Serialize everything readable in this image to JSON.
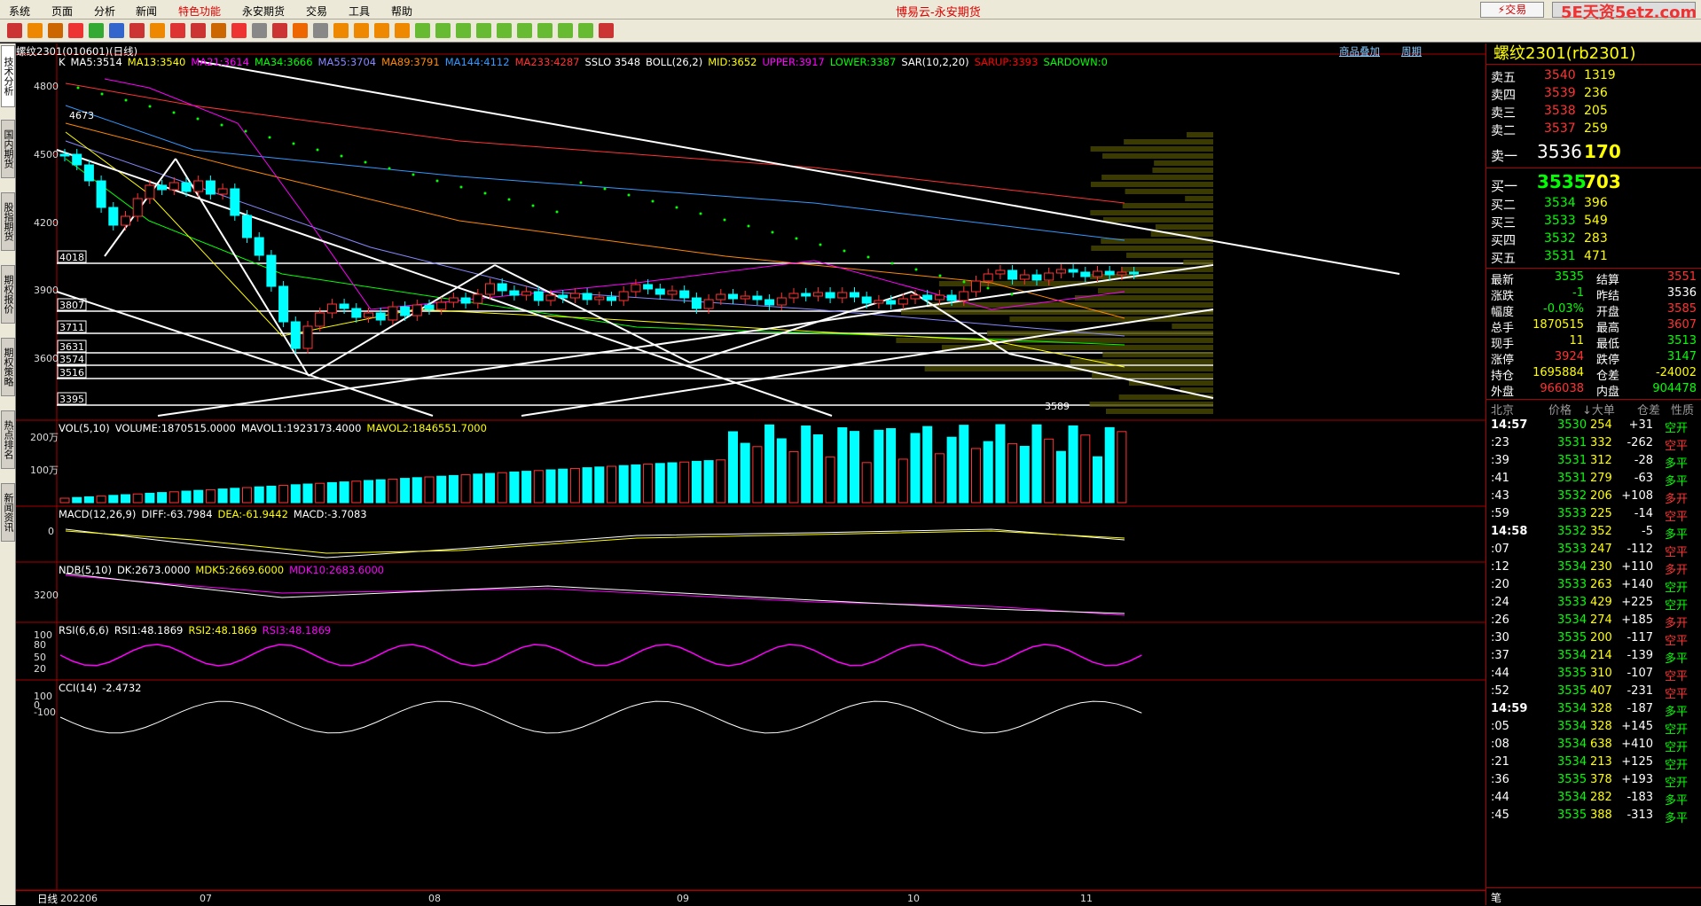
{
  "menu": [
    "系统",
    "页面",
    "分析",
    "新闻",
    "特色功能",
    "永安期货",
    "交易",
    "工具",
    "帮助"
  ],
  "window_title": "博易云-永安期货",
  "trade_button": "⚡交易",
  "watermark": "5E天资5etz.com",
  "left_tabs": [
    "技术分析",
    "国内期货",
    "股指期货",
    "期权报价",
    "期权策略",
    "热点排名",
    "新闻资讯"
  ],
  "chart": {
    "header_left": "螺纹2301(010601)(日线)",
    "header_links": [
      "商品叠加",
      "周期"
    ],
    "ma_line": [
      {
        "t": "K",
        "c": "#ffffff"
      },
      {
        "t": "MA5:3514",
        "c": "#ffffff"
      },
      {
        "t": "MA13:3540",
        "c": "#ffff00"
      },
      {
        "t": "MA21:3614",
        "c": "#ff00ff"
      },
      {
        "t": "MA34:3666",
        "c": "#00ff00"
      },
      {
        "t": "MA55:3704",
        "c": "#8888ff"
      },
      {
        "t": "MA89:3791",
        "c": "#ff8800"
      },
      {
        "t": "MA144:4112",
        "c": "#3399ff"
      },
      {
        "t": "MA233:4287",
        "c": "#ff3333"
      },
      {
        "t": "SSLO 3548",
        "c": "#ffffff"
      },
      {
        "t": "BOLL(26,2)",
        "c": "#ffffff"
      },
      {
        "t": "MID:3652",
        "c": "#ffff00"
      },
      {
        "t": "UPPER:3917",
        "c": "#ff00ff"
      },
      {
        "t": "LOWER:3387",
        "c": "#00ff00"
      },
      {
        "t": "SAR(10,2,20)",
        "c": "#ffffff"
      },
      {
        "t": "SARUP:3393",
        "c": "#ff0000"
      },
      {
        "t": "SARDOWN:0",
        "c": "#00ff00"
      }
    ],
    "price_ticks": [
      "4800",
      "4500",
      "4200",
      "3900",
      "3600"
    ],
    "price_boxes": [
      "4018",
      "3807",
      "3711",
      "3631",
      "3574",
      "3516",
      "3395"
    ],
    "high_label": "4673",
    "low_label": "3589",
    "vol_line": [
      {
        "t": "VOL(5,10)",
        "c": "#ffffff"
      },
      {
        "t": "VOLUME:1870515.0000",
        "c": "#ffffff"
      },
      {
        "t": "MAVOL1:1923173.4000",
        "c": "#ffffff"
      },
      {
        "t": "MAVOL2:1846551.7000",
        "c": "#ffff00"
      }
    ],
    "vol_ticks": [
      "200万",
      "100万"
    ],
    "macd_line": [
      {
        "t": "MACD(12,26,9)",
        "c": "#ffffff"
      },
      {
        "t": "DIFF:-63.7984",
        "c": "#ffffff"
      },
      {
        "t": "DEA:-61.9442",
        "c": "#ffff00"
      },
      {
        "t": "MACD:-3.7083",
        "c": "#ffffff"
      }
    ],
    "macd_ticks": [
      "0"
    ],
    "ndb_line": [
      {
        "t": "NDB(5,10)",
        "c": "#ffffff"
      },
      {
        "t": "DK:2673.0000",
        "c": "#ffffff"
      },
      {
        "t": "MDK5:2669.6000",
        "c": "#ffff00"
      },
      {
        "t": "MDK10:2683.6000",
        "c": "#ff00ff"
      }
    ],
    "ndb_ticks": [
      "3200"
    ],
    "rsi_line": [
      {
        "t": "RSI(6,6,6)",
        "c": "#ffffff"
      },
      {
        "t": "RSI1:48.1869",
        "c": "#ffffff"
      },
      {
        "t": "RSI2:48.1869",
        "c": "#ffff00"
      },
      {
        "t": "RSI3:48.1869",
        "c": "#ff00ff"
      }
    ],
    "rsi_ticks": [
      "100",
      "80",
      "50",
      "20"
    ],
    "cci_line": [
      {
        "t": "CCI(14)",
        "c": "#ffffff"
      },
      {
        "t": "-2.4732",
        "c": "#ffffff"
      }
    ],
    "cci_ticks": [
      "100",
      "0",
      "-100"
    ],
    "footer_label": "日线",
    "date_ticks": [
      "202206",
      "07",
      "08",
      "09",
      "10",
      "11"
    ]
  },
  "quote": {
    "title": "螺纹2301(rb2301)",
    "asks": [
      {
        "label": "卖五",
        "price": "3540",
        "vol": "1319"
      },
      {
        "label": "卖四",
        "price": "3539",
        "vol": "236"
      },
      {
        "label": "卖三",
        "price": "3538",
        "vol": "205"
      },
      {
        "label": "卖二",
        "price": "3537",
        "vol": "259"
      },
      {
        "label": "卖一",
        "price": "3536",
        "vol": "170"
      }
    ],
    "bids": [
      {
        "label": "买一",
        "price": "3535",
        "vol": "703"
      },
      {
        "label": "买二",
        "price": "3534",
        "vol": "396"
      },
      {
        "label": "买三",
        "price": "3533",
        "vol": "549"
      },
      {
        "label": "买四",
        "price": "3532",
        "vol": "283"
      },
      {
        "label": "买五",
        "price": "3531",
        "vol": "471"
      }
    ],
    "stats": [
      {
        "l1": "最新",
        "v1": "3535",
        "c1": "green",
        "l2": "结算",
        "v2": "3551",
        "c2": "red"
      },
      {
        "l1": "涨跌",
        "v1": "-1",
        "c1": "green",
        "l2": "昨结",
        "v2": "3536",
        "c2": "white"
      },
      {
        "l1": "幅度",
        "v1": "-0.03%",
        "c1": "green",
        "l2": "开盘",
        "v2": "3585",
        "c2": "red"
      },
      {
        "l1": "总手",
        "v1": "1870515",
        "c1": "yellow",
        "l2": "最高",
        "v2": "3607",
        "c2": "red"
      },
      {
        "l1": "现手",
        "v1": "11",
        "c1": "yellow",
        "l2": "最低",
        "v2": "3513",
        "c2": "green"
      },
      {
        "l1": "涨停",
        "v1": "3924",
        "c1": "red",
        "l2": "跌停",
        "v2": "3147",
        "c2": "green"
      },
      {
        "l1": "持仓",
        "v1": "1695884",
        "c1": "yellow",
        "l2": "仓差",
        "v2": "-24002",
        "c2": "yellow"
      },
      {
        "l1": "外盘",
        "v1": "966038",
        "c1": "red",
        "l2": "内盘",
        "v2": "904478",
        "c2": "green"
      }
    ],
    "ticks_header": [
      "北京",
      "价格",
      "↓大单",
      "仓差",
      "性质"
    ],
    "ticks": [
      {
        "time": "14:57",
        "price": "3530",
        "vol": "254",
        "oi": "+31",
        "nature": "空开",
        "pc": "green",
        "nc": "green",
        "bold": true
      },
      {
        "time": ":23",
        "price": "3531",
        "vol": "332",
        "oi": "-262",
        "nature": "空平",
        "pc": "green",
        "nc": "red",
        "bold": false
      },
      {
        "time": ":39",
        "price": "3531",
        "vol": "312",
        "oi": "-28",
        "nature": "多平",
        "pc": "green",
        "nc": "green",
        "bold": false
      },
      {
        "time": ":41",
        "price": "3531",
        "vol": "279",
        "oi": "-63",
        "nature": "多平",
        "pc": "green",
        "nc": "green",
        "bold": false
      },
      {
        "time": ":43",
        "price": "3532",
        "vol": "206",
        "oi": "+108",
        "nature": "多开",
        "pc": "green",
        "nc": "red",
        "bold": false
      },
      {
        "time": ":59",
        "price": "3533",
        "vol": "225",
        "oi": "-14",
        "nature": "空平",
        "pc": "green",
        "nc": "red",
        "bold": false
      },
      {
        "time": "14:58",
        "price": "3532",
        "vol": "352",
        "oi": "-5",
        "nature": "多平",
        "pc": "green",
        "nc": "green",
        "bold": true
      },
      {
        "time": ":07",
        "price": "3533",
        "vol": "247",
        "oi": "-112",
        "nature": "空平",
        "pc": "green",
        "nc": "red",
        "bold": false
      },
      {
        "time": ":12",
        "price": "3534",
        "vol": "230",
        "oi": "+110",
        "nature": "多开",
        "pc": "green",
        "nc": "red",
        "bold": false
      },
      {
        "time": ":20",
        "price": "3533",
        "vol": "263",
        "oi": "+140",
        "nature": "空开",
        "pc": "green",
        "nc": "green",
        "bold": false
      },
      {
        "time": ":24",
        "price": "3533",
        "vol": "429",
        "oi": "+225",
        "nature": "空开",
        "pc": "green",
        "nc": "green",
        "bold": false
      },
      {
        "time": ":26",
        "price": "3534",
        "vol": "274",
        "oi": "+185",
        "nature": "多开",
        "pc": "green",
        "nc": "red",
        "bold": false
      },
      {
        "time": ":30",
        "price": "3535",
        "vol": "200",
        "oi": "-117",
        "nature": "空平",
        "pc": "green",
        "nc": "red",
        "bold": false
      },
      {
        "time": ":37",
        "price": "3534",
        "vol": "214",
        "oi": "-139",
        "nature": "多平",
        "pc": "green",
        "nc": "green",
        "bold": false
      },
      {
        "time": ":44",
        "price": "3535",
        "vol": "310",
        "oi": "-107",
        "nature": "空平",
        "pc": "green",
        "nc": "red",
        "bold": false
      },
      {
        "time": ":52",
        "price": "3535",
        "vol": "407",
        "oi": "-231",
        "nature": "空平",
        "pc": "green",
        "nc": "red",
        "bold": false
      },
      {
        "time": "14:59",
        "price": "3534",
        "vol": "328",
        "oi": "-187",
        "nature": "多平",
        "pc": "green",
        "nc": "green",
        "bold": true
      },
      {
        "time": ":05",
        "price": "3534",
        "vol": "328",
        "oi": "+145",
        "nature": "空开",
        "pc": "green",
        "nc": "green",
        "bold": false
      },
      {
        "time": ":08",
        "price": "3534",
        "vol": "638",
        "oi": "+410",
        "nature": "空开",
        "pc": "green",
        "nc": "green",
        "bold": false
      },
      {
        "time": ":21",
        "price": "3534",
        "vol": "213",
        "oi": "+125",
        "nature": "空开",
        "pc": "green",
        "nc": "green",
        "bold": false
      },
      {
        "time": ":36",
        "price": "3535",
        "vol": "378",
        "oi": "+193",
        "nature": "空开",
        "pc": "green",
        "nc": "green",
        "bold": false
      },
      {
        "time": ":44",
        "price": "3534",
        "vol": "282",
        "oi": "-183",
        "nature": "多平",
        "pc": "green",
        "nc": "green",
        "bold": false
      },
      {
        "time": ":45",
        "price": "3535",
        "vol": "388",
        "oi": "-313",
        "nature": "多平",
        "pc": "green",
        "nc": "green",
        "bold": false
      }
    ],
    "footer_label": "笔"
  }
}
